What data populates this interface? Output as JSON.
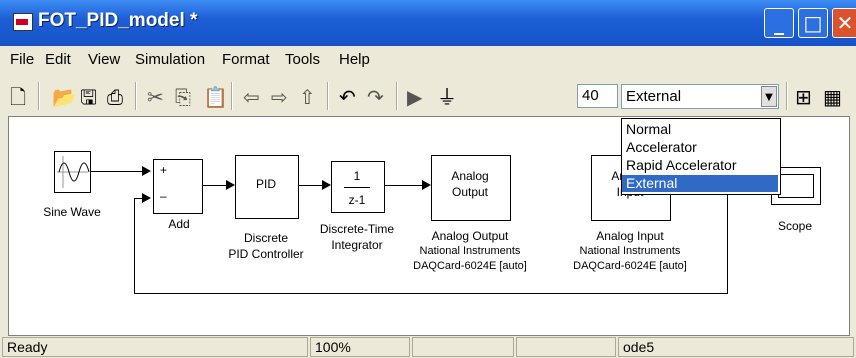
{
  "window": {
    "title": "FOT_PID_model *",
    "minimize": "_",
    "maximize": "□",
    "close": "✕"
  },
  "menu": [
    "File",
    "Edit",
    "View",
    "Simulation",
    "Format",
    "Tools",
    "Help"
  ],
  "toolbar": {
    "stop_time": "40",
    "sim_mode": "External"
  },
  "mode_options": [
    "Normal",
    "Accelerator",
    "Rapid Accelerator",
    "External"
  ],
  "blocks": {
    "sine": "Sine Wave",
    "add": "Add",
    "pid": "PID",
    "pid_label1": "Discrete",
    "pid_label2": "PID Controller",
    "int_num": "1",
    "int_den": "z-1",
    "int_label1": "Discrete-Time",
    "int_label2": "Integrator",
    "ao_text1": "Analog",
    "ao_text2": "Output",
    "ao_label1": "Analog Output",
    "ao_label2": "National Instruments",
    "ao_label3": "DAQCard-6024E [auto]",
    "ai_text1": "Analog",
    "ai_text2": "Input",
    "ai_label1": "Analog Input",
    "ai_label2": "National Instruments",
    "ai_label3": "DAQCard-6024E [auto]",
    "scope": "Scope",
    "plus": "+",
    "minus": "–"
  },
  "status": {
    "state": "Ready",
    "zoom": "100%",
    "solver": "ode5"
  }
}
